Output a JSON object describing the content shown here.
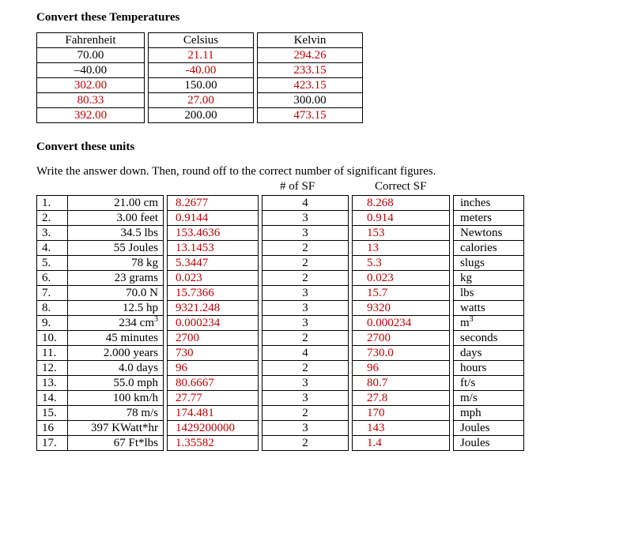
{
  "heading1": "Convert these Temperatures",
  "temp_table": {
    "headers": [
      "Fahrenheit",
      "Celsius",
      "Kelvin"
    ],
    "rows": [
      {
        "f": "70.00",
        "c": "21.11",
        "k": "294.26",
        "f_red": false,
        "c_red": true,
        "k_red": true
      },
      {
        "f": "–40.00",
        "c": "-40.00",
        "k": "233.15",
        "f_red": false,
        "c_red": true,
        "k_red": true
      },
      {
        "f": "302.00",
        "c": "150.00",
        "k": "423.15",
        "f_red": true,
        "c_red": false,
        "k_red": true
      },
      {
        "f": "80.33",
        "c": "27.00",
        "k": "300.00",
        "f_red": true,
        "c_red": true,
        "k_red": false
      },
      {
        "f": "392.00",
        "c": "200.00",
        "k": "473.15",
        "f_red": true,
        "c_red": false,
        "k_red": true
      }
    ]
  },
  "heading2": "Convert these units",
  "instruction": "Write the answer down. Then, round off to the correct number of significant figures.",
  "col_headers": {
    "sf": "# of  SF",
    "correct": "Correct SF"
  },
  "units_rows": [
    {
      "n": "1.",
      "given": "21.00 cm",
      "raw": "8.2677",
      "sf": "4",
      "correct": "8.268",
      "unit": "inches"
    },
    {
      "n": "2.",
      "given": "3.00 feet",
      "raw": "0.9144",
      "sf": "3",
      "correct": "0.914",
      "unit": "meters"
    },
    {
      "n": "3.",
      "given": "34.5 lbs",
      "raw": "153.4636",
      "sf": "3",
      "correct": "153",
      "unit": "Newtons"
    },
    {
      "n": "4.",
      "given": "55 Joules",
      "raw": "13.1453",
      "sf": "2",
      "correct": "13",
      "unit": "calories"
    },
    {
      "n": "5.",
      "given": "78 kg",
      "raw": "5.3447",
      "sf": "2",
      "correct": "5.3",
      "unit": "slugs"
    },
    {
      "n": "6.",
      "given": "23 grams",
      "raw": "0.023",
      "sf": "2",
      "correct": "0.023",
      "unit": "kg"
    },
    {
      "n": "7.",
      "given": "70.0 N",
      "raw": "15.7366",
      "sf": "3",
      "correct": "15.7",
      "unit": "lbs"
    },
    {
      "n": "8.",
      "given": "12.5 hp",
      "raw": "9321.248",
      "sf": "3",
      "correct": "9320",
      "unit": "watts"
    },
    {
      "n": "9.",
      "given": "234 cm",
      "raw": "0.000234",
      "sf": "3",
      "correct": "0.000234",
      "unit": "m",
      "given_sup": "3",
      "unit_sup": "3"
    },
    {
      "n": "10.",
      "given": "45 minutes",
      "raw": "2700",
      "sf": "2",
      "correct": "2700",
      "unit": "seconds"
    },
    {
      "n": "11.",
      "given": "2.000 years",
      "raw": "730",
      "sf": "4",
      "correct": "730.0",
      "unit": "days"
    },
    {
      "n": "12.",
      "given": "4.0 days",
      "raw": "96",
      "sf": "2",
      "correct": "96",
      "unit": "hours"
    },
    {
      "n": "13.",
      "given": "55.0 mph",
      "raw": "80.6667",
      "sf": "3",
      "correct": "80.7",
      "unit": "ft/s"
    },
    {
      "n": "14.",
      "given": "100 km/h",
      "raw": "27.77",
      "sf": "3",
      "correct": "27.8",
      "unit": "m/s"
    },
    {
      "n": "15.",
      "given": "78 m/s",
      "raw": "174.481",
      "sf": "2",
      "correct": "170",
      "unit": "mph"
    },
    {
      "n": "16",
      "given": "397 KWatt*hr",
      "raw": "1429200000",
      "sf": "3",
      "correct": "143",
      "unit": "Joules"
    },
    {
      "n": "17.",
      "given": "67 Ft*lbs",
      "raw": "1.35582",
      "sf": "2",
      "correct": "1.4",
      "unit": "Joules"
    }
  ]
}
